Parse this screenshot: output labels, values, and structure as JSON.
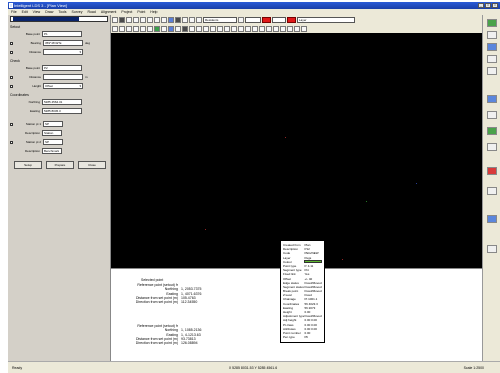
{
  "window": {
    "title": "Intelligent LDS 3 - [Plan View]"
  },
  "menu": [
    "File",
    "Edit",
    "View",
    "Draw",
    "Tools",
    "Survey",
    "Road",
    "Alignment",
    "Project",
    "Point",
    "Help"
  ],
  "toolbar": {
    "combo_left": "Residents",
    "combo_right": "Layer",
    "combo_wide": "",
    "color_accent": "#e01818"
  },
  "left_panel": {
    "selector": "",
    "sections": [
      {
        "title": "Setout",
        "rows": [
          {
            "label": "Base point",
            "value": "P1"
          },
          {
            "label": "Bearing",
            "value": "359°46'32\"E",
            "unit": "deg"
          },
          {
            "label": "Distance",
            "value": ""
          }
        ]
      },
      {
        "title": "Check",
        "rows": [
          {
            "label": "Base point",
            "value": "P2"
          },
          {
            "label": "Distance",
            "value": "",
            "unit": "m"
          },
          {
            "label": "Height",
            "value": "Offset"
          }
        ]
      },
      {
        "title": "Coordinates",
        "rows": [
          {
            "label": "Northing",
            "value": "5285 4564.31"
          },
          {
            "label": "Easting",
            "value": "5285 8045.3"
          }
        ]
      }
    ],
    "points": [
      {
        "label": "Station pt 1",
        "value": "SP"
      },
      {
        "label": "Description",
        "value": "Station"
      },
      {
        "label": "Station pt 2",
        "value": "SP"
      },
      {
        "label": "Description",
        "value": "Benchmark"
      }
    ],
    "buttons": [
      "Setup",
      "Prepare",
      "Close"
    ]
  },
  "report": {
    "label": "Selected point",
    "blocks": [
      {
        "rows": [
          {
            "label": "Reference point (setout) fr",
            "value": ""
          },
          {
            "label": "Northing",
            "value": "1, 2053.7375"
          },
          {
            "label": "Easting",
            "value": "1, 4071.6376"
          },
          {
            "label": "Distance from set point (m)",
            "value": "105.4763"
          },
          {
            "label": "Direction from set point (m)",
            "value": "112.34550"
          }
        ]
      },
      {
        "rows": [
          {
            "label": "Reference point (setout) fr",
            "value": ""
          },
          {
            "label": "Northing",
            "value": "1, 1085.2136"
          },
          {
            "label": "Easting",
            "value": "1, 4-1213.63"
          },
          {
            "label": "Distance from set point (m)",
            "value": "93.73813"
          },
          {
            "label": "Direction from set point (m)",
            "value": "126.08894"
          }
        ]
      }
    ]
  },
  "popup": {
    "rows": [
      {
        "k": "Created from",
        "v": "Plan"
      },
      {
        "k": "Description",
        "v": "P12"
      },
      {
        "k": "Code",
        "v": "PEG/NEW"
      },
      {
        "k": "Layer",
        "v": "Pegs"
      },
      {
        "k": "Colour",
        "v": "",
        "swatch": "#5fb830"
      },
      {
        "k": "Point type",
        "v": "P. 4.11"
      },
      {
        "k": "Segment type",
        "v": "Pnt"
      },
      {
        "k": "Fixed link",
        "v": "Yes"
      },
      {
        "k": "Offset",
        "v": "+/- 40"
      },
      {
        "k": "Edge status",
        "v": "Fixed/Moved"
      },
      {
        "k": "Segment status",
        "v": "Fixed/Moved"
      },
      {
        "k": "Break point",
        "v": "Fixed/Moved"
      },
      {
        "k": "Z level",
        "v": "Fixed"
      },
      {
        "k": "Chainage",
        "v": "Pt 1001.1"
      },
      {
        "k": "Coordinates",
        "v": "56 4023.3"
      },
      {
        "k": "Easting",
        "v": "56 2073"
      },
      {
        "k": "Height",
        "v": "0.00"
      },
      {
        "k": "Adjustment type",
        "v": "Fixed/Moved"
      },
      {
        "k": "Adj height",
        "v": "0.00 0.00"
      },
      {
        "k": "Pt class",
        "v": "0.00 0.00"
      },
      {
        "k": "Attributes",
        "v": "0.00 0.00"
      },
      {
        "k": "Point number",
        "v": "0.00"
      },
      {
        "k": "Pen type",
        "v": "Plt"
      }
    ]
  },
  "status": {
    "left": "Ready",
    "mid": "X 5285 8031.53 Y 5285 4561.6",
    "right": "Scale 1:2500"
  }
}
